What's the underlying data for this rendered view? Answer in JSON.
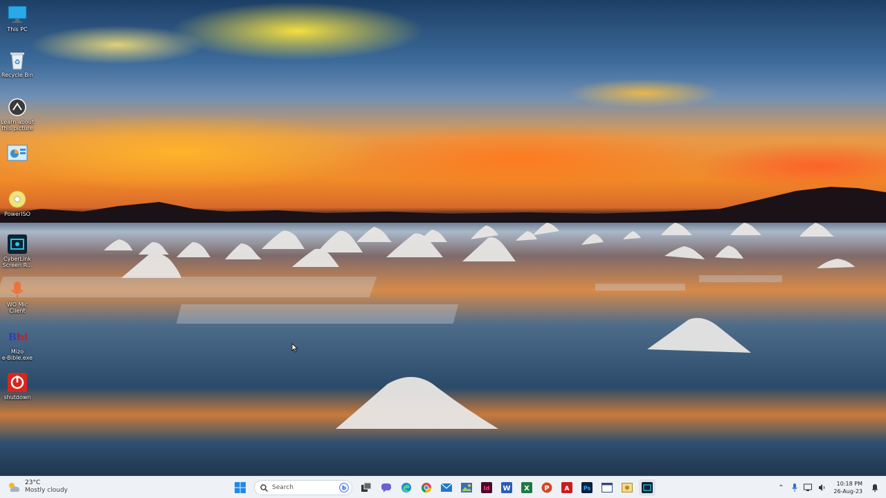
{
  "desktop": {
    "icons": [
      {
        "label": "This PC",
        "icon": "monitor-icon"
      },
      {
        "label": "Recycle Bin",
        "icon": "recycle-bin-icon"
      },
      {
        "label": "Learn about\nthis picture",
        "icon": "camera-icon"
      },
      {
        "label": "",
        "icon": "control-panel-icon"
      },
      {
        "label": "PowerISO",
        "icon": "disc-icon"
      },
      {
        "label": "CyberLink\nScreen R...",
        "icon": "screen-recorder-icon"
      },
      {
        "label": "WO Mic\nClient",
        "icon": "microphone-icon"
      },
      {
        "label": "Mizo\ne-Bible.exe",
        "icon": "bible-icon"
      },
      {
        "label": "shutdown",
        "icon": "power-icon"
      }
    ]
  },
  "taskbar": {
    "weather": {
      "temp": "23°C",
      "condition": "Mostly cloudy",
      "icon": "partly-cloudy-icon"
    },
    "search_placeholder": "Search",
    "apps": [
      "start-icon",
      "search",
      "task-view-icon",
      "chat-icon",
      "edge-icon",
      "chrome-icon",
      "mail-icon",
      "photos-icon",
      "indesign-icon",
      "word-icon",
      "excel-icon",
      "powerpoint-icon",
      "acrobat-icon",
      "photoshop-icon",
      "window-icon",
      "media-icon",
      "terminal-icon"
    ],
    "tray": {
      "time": "10:18 PM",
      "date": "26-Aug-23"
    }
  },
  "colors": {
    "taskbar_bg": "#eef1f6",
    "accent": "#0067c0"
  }
}
